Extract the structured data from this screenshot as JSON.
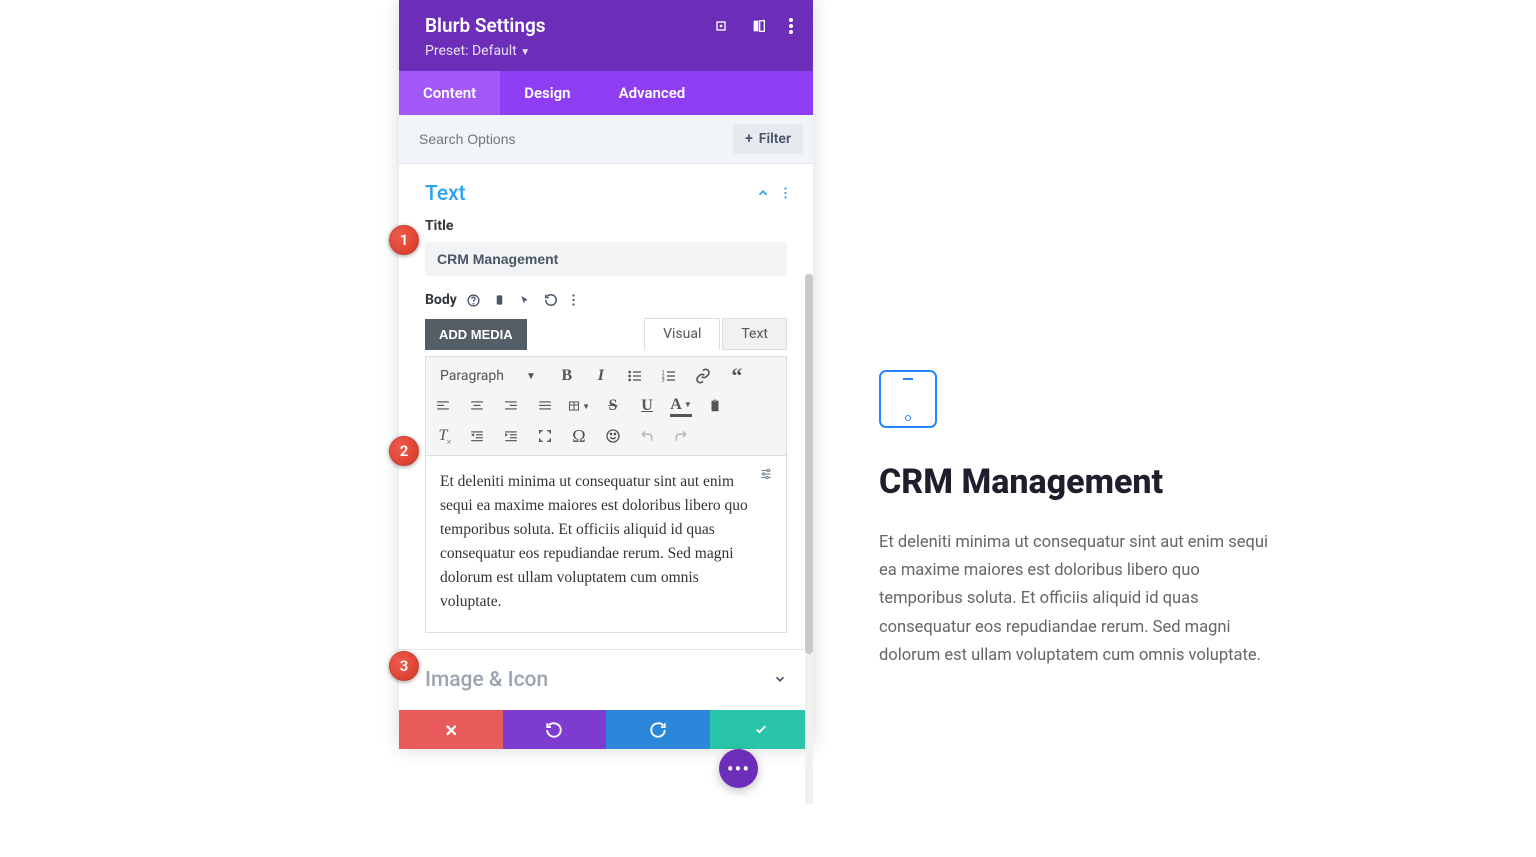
{
  "modal": {
    "title": "Blurb Settings",
    "preset_label": "Preset: Default",
    "tabs": [
      "Content",
      "Design",
      "Advanced"
    ],
    "search_placeholder": "Search Options",
    "filter_label": "Filter"
  },
  "sections": {
    "text": {
      "title": "Text",
      "title_label": "Title",
      "title_value": "CRM Management",
      "body_label": "Body",
      "add_media": "ADD MEDIA",
      "visual_tab": "Visual",
      "text_tab": "Text",
      "paragraph": "Paragraph",
      "body_content": "Et deleniti minima ut consequatur sint aut enim sequi ea maxime maiores est doloribus libero quo temporibus soluta. Et officiis aliquid id quas consequatur eos repudiandae rerum. Sed magni dolorum est ullam voluptatem cum omnis voluptate."
    },
    "image_icon": {
      "title": "Image & Icon"
    }
  },
  "markers": {
    "m1": "1",
    "m2": "2",
    "m3": "3"
  },
  "preview": {
    "title": "CRM Management",
    "body": "Et deleniti minima ut consequatur sint aut enim sequi ea maxime maiores est doloribus libero quo temporibus soluta. Et officiis aliquid id quas consequatur eos repudiandae rerum. Sed magni dolorum est ullam voluptatem cum omnis voluptate."
  },
  "fab": "•••"
}
